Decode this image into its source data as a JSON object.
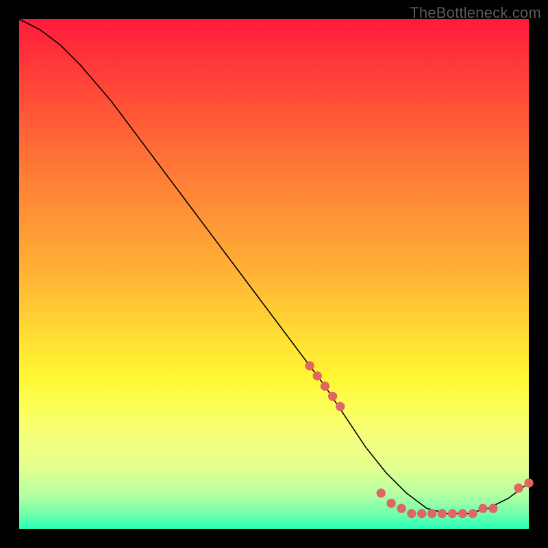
{
  "watermark": "TheBottleneck.com",
  "chart_data": {
    "type": "line",
    "title": "",
    "xlabel": "",
    "ylabel": "",
    "xlim": [
      0,
      100
    ],
    "ylim": [
      0,
      100
    ],
    "series": [
      {
        "name": "curve",
        "x": [
          0,
          4,
          8,
          12,
          18,
          24,
          30,
          36,
          42,
          48,
          54,
          60,
          64,
          68,
          72,
          76,
          80,
          84,
          88,
          92,
          96,
          100
        ],
        "y": [
          100,
          98,
          95,
          91,
          84,
          76,
          68,
          60,
          52,
          44,
          36,
          28,
          22,
          16,
          11,
          7,
          4,
          3,
          3,
          4,
          6,
          9
        ]
      }
    ],
    "markers": {
      "name": "highlight-points",
      "color": "#e06666",
      "x": [
        57,
        58.5,
        60,
        61.5,
        63,
        71,
        73,
        75,
        77,
        79,
        81,
        83,
        85,
        87,
        89,
        91,
        93,
        98,
        100
      ],
      "y": [
        32,
        30,
        28,
        26,
        24,
        7,
        5,
        4,
        3,
        3,
        3,
        3,
        3,
        3,
        3,
        4,
        4,
        8,
        9
      ]
    },
    "colors": {
      "line": "#000000",
      "marker": "#e06666"
    }
  }
}
